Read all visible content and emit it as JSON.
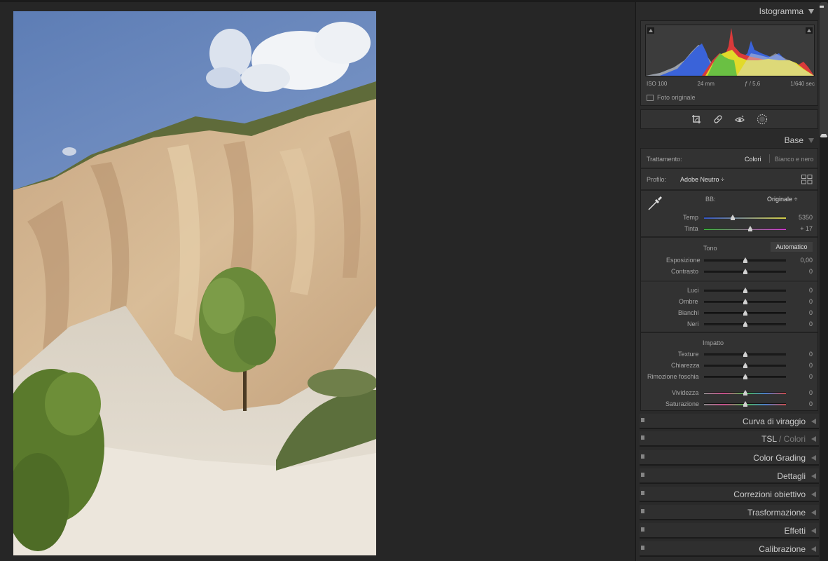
{
  "histogram": {
    "title": "Istogramma",
    "iso": "ISO 100",
    "focal": "24 mm",
    "aperture": "ƒ / 5,6",
    "shutter": "1/640 sec",
    "original_photo_label": "Foto originale",
    "original_photo_checked": false
  },
  "tools": [
    "crop-icon",
    "healing-icon",
    "red-eye-icon",
    "masking-icon"
  ],
  "base": {
    "title": "Base",
    "treatment_label": "Trattamento:",
    "treatment_color": "Colori",
    "treatment_bw": "Bianco e nero",
    "profile_label": "Profilo:",
    "profile_value": "Adobe Neutro ÷",
    "wb_label": "BB:",
    "wb_value": "Originale ÷",
    "tone_label": "Tono",
    "auto_button": "Automatico",
    "presence_label": "Impatto",
    "sliders": {
      "temp": {
        "label": "Temp",
        "value": "5350",
        "level": 0.35
      },
      "tint": {
        "label": "Tinta",
        "value": "+ 17",
        "level": 0.56
      },
      "exposure": {
        "label": "Esposizione",
        "value": "0,00",
        "level": 0.5
      },
      "contrast": {
        "label": "Contrasto",
        "value": "0",
        "level": 0.5
      },
      "highlights": {
        "label": "Luci",
        "value": "0",
        "level": 0.5
      },
      "shadows": {
        "label": "Ombre",
        "value": "0",
        "level": 0.5
      },
      "whites": {
        "label": "Bianchi",
        "value": "0",
        "level": 0.5
      },
      "blacks": {
        "label": "Neri",
        "value": "0",
        "level": 0.5
      },
      "texture": {
        "label": "Texture",
        "value": "0",
        "level": 0.5
      },
      "clarity": {
        "label": "Chiarezza",
        "value": "0",
        "level": 0.5
      },
      "dehaze": {
        "label": "Rimozione foschia",
        "value": "0",
        "level": 0.5
      },
      "vibrance": {
        "label": "Vividezza",
        "value": "0",
        "level": 0.5
      },
      "saturation": {
        "label": "Saturazione",
        "value": "0",
        "level": 0.5
      }
    }
  },
  "sections": {
    "tone_curve": "Curva di viraggio",
    "hsl_a": "TSL",
    "hsl_sep": " / ",
    "hsl_b": "Colori",
    "color_grading": "Color Grading",
    "detail": "Dettagli",
    "lens": "Correzioni obiettivo",
    "transform": "Trasformazione",
    "effects": "Effetti",
    "calibration": "Calibrazione"
  },
  "colors": {
    "background": "#262626",
    "panel": "#2a2a2a",
    "accent": "#cacaca"
  }
}
